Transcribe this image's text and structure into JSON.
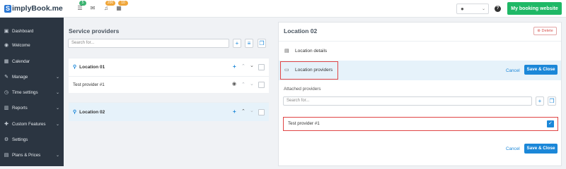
{
  "header": {
    "logo_text": "implyBook.me",
    "logo_letter": "S",
    "badges": {
      "tasks": "5",
      "notifications": "200",
      "calendar": "10"
    },
    "booking_button": "My booking website"
  },
  "sidebar": {
    "items": [
      {
        "label": "Dashboard",
        "icon": "dashboard-icon",
        "glyph": "▣",
        "chevron": false
      },
      {
        "label": "Welcome",
        "icon": "welcome-icon",
        "glyph": "◉",
        "chevron": false
      },
      {
        "label": "Calendar",
        "icon": "calendar-icon",
        "glyph": "▦",
        "chevron": false
      },
      {
        "label": "Manage",
        "icon": "pencil-icon",
        "glyph": "✎",
        "chevron": true
      },
      {
        "label": "Time settings",
        "icon": "clock-icon",
        "glyph": "◷",
        "chevron": true
      },
      {
        "label": "Reports",
        "icon": "bar-chart-icon",
        "glyph": "▥",
        "chevron": true
      },
      {
        "label": "Custom Features",
        "icon": "puzzle-icon",
        "glyph": "✚",
        "chevron": true
      },
      {
        "label": "Settings",
        "icon": "gear-icon",
        "glyph": "⚙",
        "chevron": false
      },
      {
        "label": "Plans & Prices",
        "icon": "plans-icon",
        "glyph": "▤",
        "chevron": true
      }
    ]
  },
  "left_panel": {
    "title": "Service providers",
    "search_placeholder": "Search for...",
    "locations": [
      {
        "name": "Location 01",
        "provider": "Test provider #1"
      },
      {
        "name": "Location 02"
      }
    ]
  },
  "right_panel": {
    "title": "Location 02",
    "delete_label": "Delete",
    "menu": [
      {
        "label": "Location details",
        "icon": "document-icon"
      },
      {
        "label": "Location providers",
        "icon": "folder-icon"
      }
    ],
    "cancel_label": "Cancel",
    "save_label": "Save & Close",
    "attached_label": "Attached providers",
    "search_placeholder": "Search for...",
    "attached_providers": [
      {
        "name": "Test provider #1",
        "checked": true
      }
    ]
  },
  "colors": {
    "accent": "#1b87d8",
    "brand_green": "#1fb866",
    "sidebar": "#2b3541",
    "highlight": "#e04545"
  }
}
